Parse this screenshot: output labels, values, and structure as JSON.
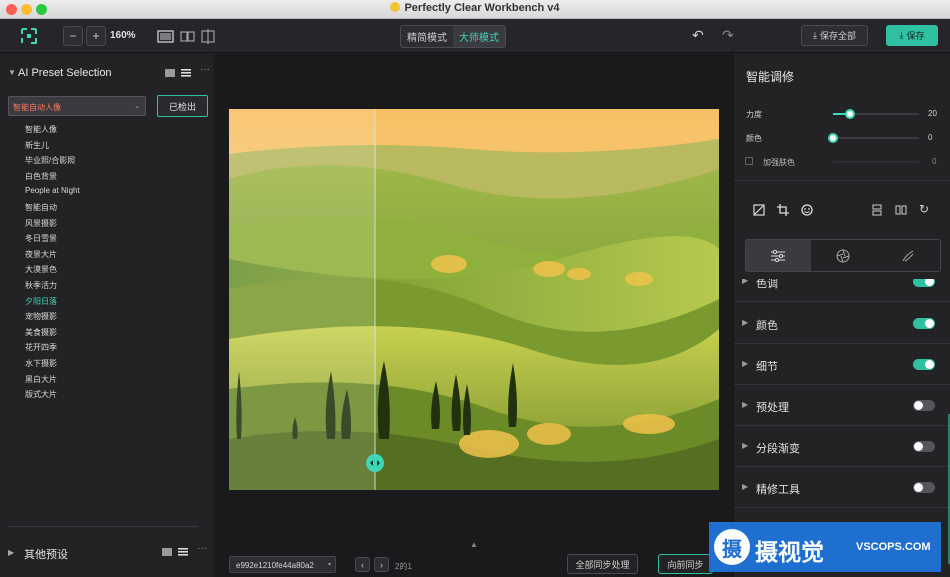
{
  "window": {
    "title": "Perfectly Clear Workbench v4"
  },
  "toolbar": {
    "zoom_minus": "−",
    "zoom_plus": "+",
    "zoom_level": "160%",
    "mode_simple": "精简模式",
    "mode_master": "大师模式",
    "save_all": "保存全部",
    "save": "保存"
  },
  "left": {
    "section_title": "AI Preset Selection",
    "selected_preset": "智能自动人像",
    "detected_button": "已检出",
    "presets": [
      "智能人像",
      "新生儿",
      "毕业照/合影照",
      "白色背景",
      "People at Night",
      "智能自动",
      "风景摄影",
      "冬日雪景",
      "夜景大片",
      "大漠景色",
      "秋季活力",
      "夕阳日落",
      "宠物摄影",
      "美食摄影",
      "花开四季",
      "水下摄影",
      "黑白大片",
      "版式大片"
    ],
    "active_preset_index": 11,
    "other_presets": "其他预设"
  },
  "center": {
    "file_id": "e992e1210fe44a80a2",
    "page_indicator": "2的1",
    "sync_all": "全部同步处理",
    "sync_forward": "向前同步"
  },
  "right": {
    "title": "智能调修",
    "sliders": [
      {
        "label": "力度",
        "value": "20",
        "fraction": 0.2
      },
      {
        "label": "颜色",
        "value": "0",
        "fraction": 0.0
      }
    ],
    "enhance_skin_label": "加强肤色",
    "enhance_skin_value": "0",
    "sections": [
      {
        "label": "色调",
        "on": true
      },
      {
        "label": "颜色",
        "on": true
      },
      {
        "label": "细节",
        "on": true
      },
      {
        "label": "预处理",
        "on": false
      },
      {
        "label": "分段渐变",
        "on": false
      },
      {
        "label": "精修工具",
        "on": false
      }
    ]
  },
  "watermark": {
    "brand": "摄视觉",
    "site": "VSCOPS.COM"
  },
  "colors": {
    "accent": "#3ed6b7",
    "panel": "#232326",
    "canvas": "#1a1a1c"
  }
}
